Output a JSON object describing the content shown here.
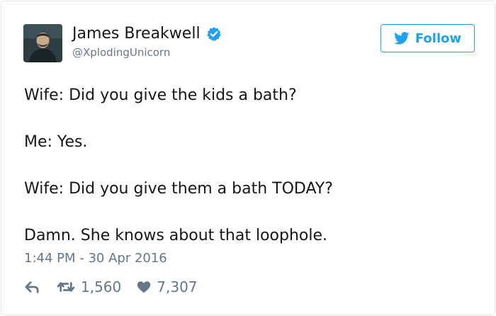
{
  "author": {
    "display_name": "James Breakwell",
    "handle": "@XplodingUnicorn",
    "verified": true
  },
  "follow_button": {
    "label": "Follow",
    "icon": "twitter-bird-icon"
  },
  "tweet": {
    "lines": [
      "Wife: Did you give the kids a bath?",
      "Me: Yes.",
      "Wife: Did you give them a bath TODAY?",
      "Damn. She knows about that loophole."
    ],
    "timestamp": "1:44 PM - 30 Apr 2016"
  },
  "actions": {
    "reply_icon": "reply-icon",
    "retweet_icon": "retweet-icon",
    "retweet_count": "1,560",
    "like_icon": "heart-icon",
    "like_count": "7,307"
  },
  "colors": {
    "accent": "#1da1f2",
    "verified": "#1da1f2",
    "text": "#14171a",
    "muted": "#657786",
    "border": "#e1e8ed"
  }
}
